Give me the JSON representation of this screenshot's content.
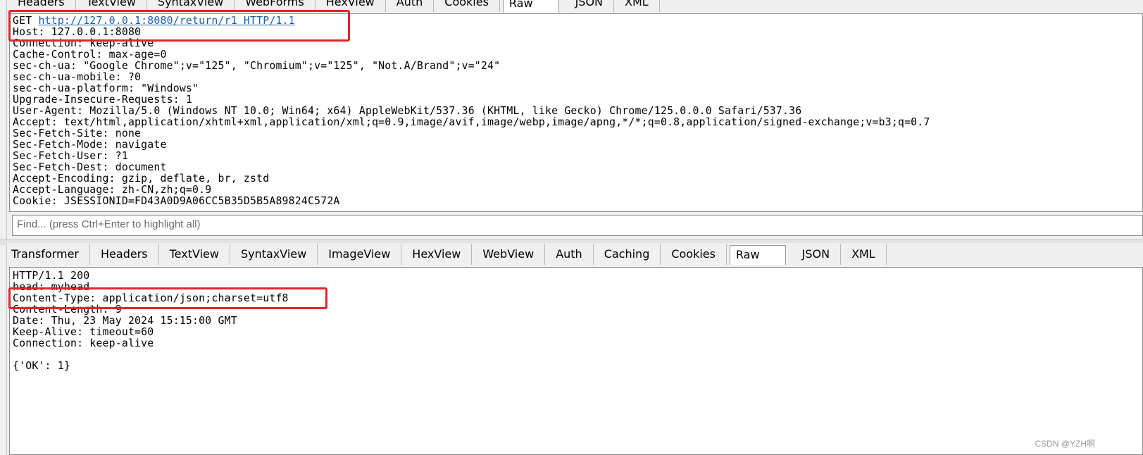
{
  "request": {
    "tabs": [
      "Headers",
      "TextView",
      "SyntaxView",
      "WebForms",
      "HexView",
      "Auth",
      "Cookies",
      "Raw",
      "JSON",
      "XML"
    ],
    "active_tab": "Raw",
    "method": "GET ",
    "url_line": "http://127.0.0.1:8080/return/r1 HTTP/1.1",
    "lines": [
      "Host: 127.0.0.1:8080",
      "Connection: keep-alive",
      "Cache-Control: max-age=0",
      "sec-ch-ua: \"Google Chrome\";v=\"125\", \"Chromium\";v=\"125\", \"Not.A/Brand\";v=\"24\"",
      "sec-ch-ua-mobile: ?0",
      "sec-ch-ua-platform: \"Windows\"",
      "Upgrade-Insecure-Requests: 1",
      "User-Agent: Mozilla/5.0 (Windows NT 10.0; Win64; x64) AppleWebKit/537.36 (KHTML, like Gecko) Chrome/125.0.0.0 Safari/537.36",
      "Accept: text/html,application/xhtml+xml,application/xml;q=0.9,image/avif,image/webp,image/apng,*/*;q=0.8,application/signed-exchange;v=b3;q=0.7",
      "Sec-Fetch-Site: none",
      "Sec-Fetch-Mode: navigate",
      "Sec-Fetch-User: ?1",
      "Sec-Fetch-Dest: document",
      "Accept-Encoding: gzip, deflate, br, zstd",
      "Accept-Language: zh-CN,zh;q=0.9",
      "Cookie: JSESSIONID=FD43A0D9A06CC5B35D5B5A89824C572A"
    ]
  },
  "find": {
    "placeholder": "Find... (press Ctrl+Enter to highlight all)"
  },
  "response": {
    "tabs": [
      "Transformer",
      "Headers",
      "TextView",
      "SyntaxView",
      "ImageView",
      "HexView",
      "WebView",
      "Auth",
      "Caching",
      "Cookies",
      "Raw",
      "JSON",
      "XML"
    ],
    "active_tab": "Raw",
    "lines": [
      "HTTP/1.1 200",
      "head: myhead",
      "Content-Type: application/json;charset=utf8",
      "Content-Length: 9",
      "Date: Thu, 23 May 2024 15:15:00 GMT",
      "Keep-Alive: timeout=60",
      "Connection: keep-alive",
      "",
      "{'OK': 1}"
    ]
  },
  "watermark": "CSDN @YZH啊",
  "colors": {
    "highlight": "#e0252a",
    "link": "#1a5fb4"
  }
}
